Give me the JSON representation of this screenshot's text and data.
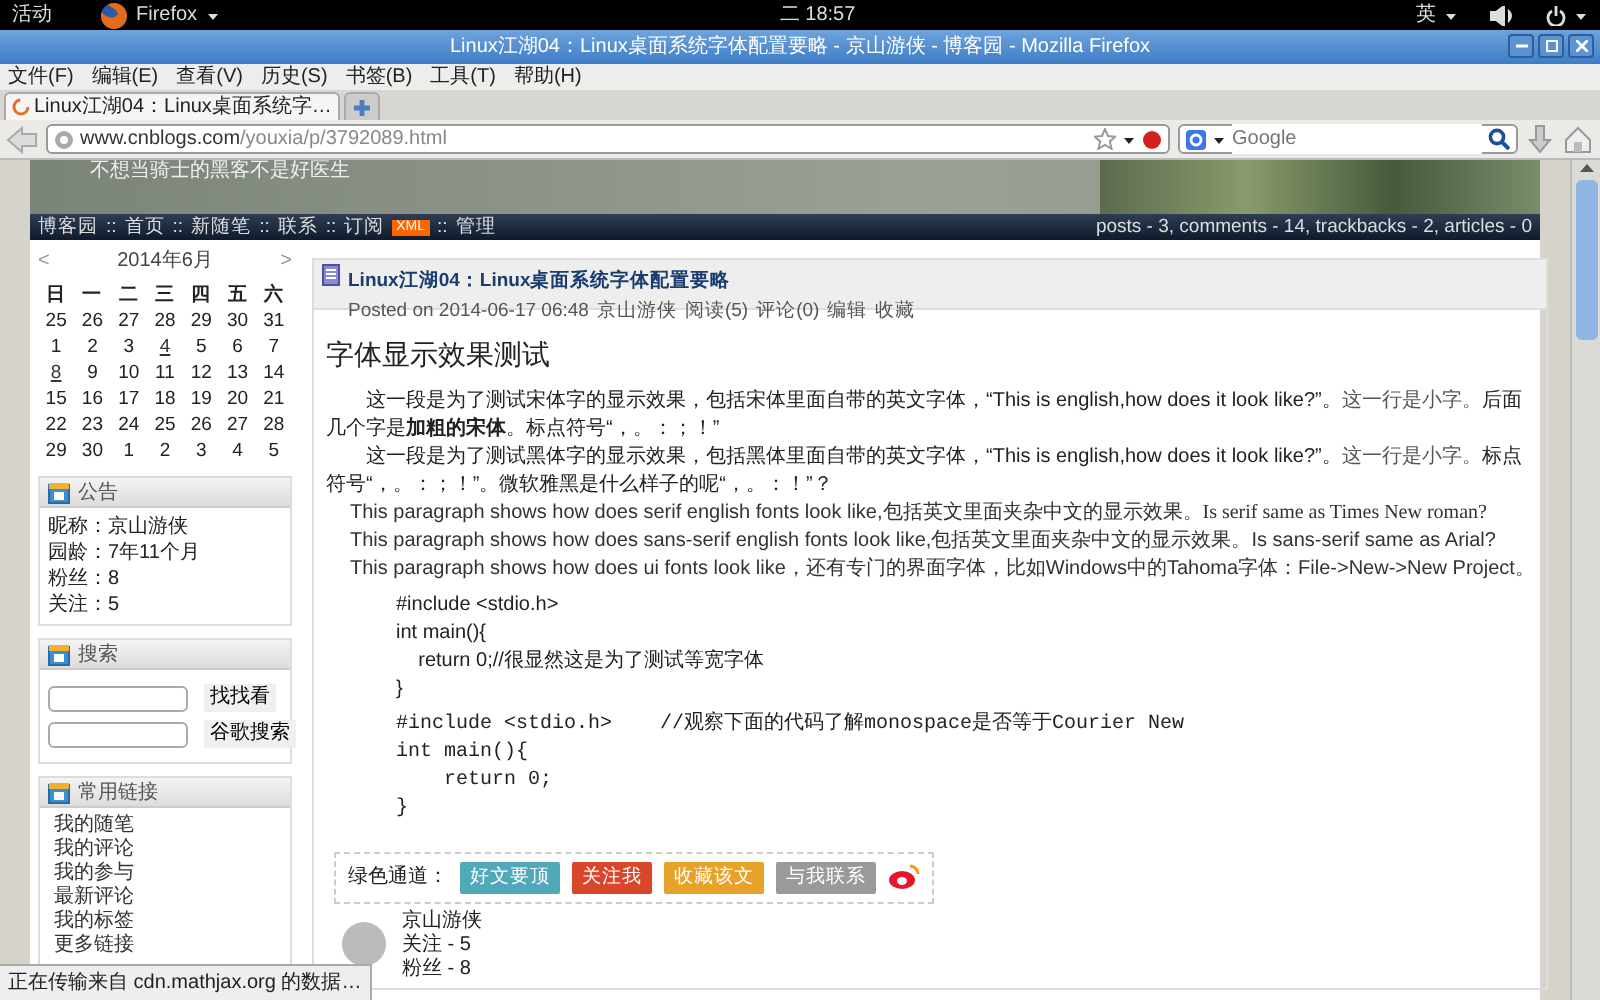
{
  "top_bar": {
    "activities": "活动",
    "app": "Firefox",
    "clock": "二 18:57",
    "input_method": "英"
  },
  "window": {
    "title": "Linux江湖04：Linux桌面系统字体配置要略 - 京山游侠 - 博客园 - Mozilla Firefox"
  },
  "menu": [
    "文件(F)",
    "编辑(E)",
    "查看(V)",
    "历史(S)",
    "书签(B)",
    "工具(T)",
    "帮助(H)"
  ],
  "tabs": [
    {
      "label": "Linux江湖04：Linux桌面系统字…",
      "selected": true
    }
  ],
  "address": {
    "host": "www.cnblogs.com",
    "path": "/youxia/p/3792089.html"
  },
  "search": {
    "placeholder": "Google"
  },
  "blog": {
    "subtitle": "不想当骑士的黑客不是好医生",
    "separator": "::",
    "nav": [
      {
        "label": "博客园"
      },
      {
        "label": "首页"
      },
      {
        "label": "新随笔"
      },
      {
        "label": "联系"
      },
      {
        "label": "订阅",
        "badge": "XML"
      },
      {
        "label": "管理"
      }
    ],
    "stats": "posts - 3, comments - 14, trackbacks - 2, articles - 0"
  },
  "calendar": {
    "prev": "<",
    "title": "2014年6月",
    "next": ">",
    "weekdays": [
      "日",
      "一",
      "二",
      "三",
      "四",
      "五",
      "六"
    ],
    "weeks": [
      [
        {
          "d": "25",
          "link": false
        },
        {
          "d": "26",
          "link": false
        },
        {
          "d": "27",
          "link": false
        },
        {
          "d": "28",
          "link": false
        },
        {
          "d": "29",
          "link": false
        },
        {
          "d": "30",
          "link": false
        },
        {
          "d": "31",
          "link": false
        }
      ],
      [
        {
          "d": "1",
          "link": false
        },
        {
          "d": "2",
          "link": false
        },
        {
          "d": "3",
          "link": false
        },
        {
          "d": "4",
          "link": true
        },
        {
          "d": "5",
          "link": false
        },
        {
          "d": "6",
          "link": false
        },
        {
          "d": "7",
          "link": false
        }
      ],
      [
        {
          "d": "8",
          "link": true
        },
        {
          "d": "9",
          "link": false
        },
        {
          "d": "10",
          "link": false
        },
        {
          "d": "11",
          "link": false
        },
        {
          "d": "12",
          "link": false
        },
        {
          "d": "13",
          "link": false
        },
        {
          "d": "14",
          "link": false
        }
      ],
      [
        {
          "d": "15",
          "link": false
        },
        {
          "d": "16",
          "link": false
        },
        {
          "d": "17",
          "link": false
        },
        {
          "d": "18",
          "link": false
        },
        {
          "d": "19",
          "link": false
        },
        {
          "d": "20",
          "link": false
        },
        {
          "d": "21",
          "link": false
        }
      ],
      [
        {
          "d": "22",
          "link": false
        },
        {
          "d": "23",
          "link": false
        },
        {
          "d": "24",
          "link": false
        },
        {
          "d": "25",
          "link": false
        },
        {
          "d": "26",
          "link": false
        },
        {
          "d": "27",
          "link": false
        },
        {
          "d": "28",
          "link": false
        }
      ],
      [
        {
          "d": "29",
          "link": false
        },
        {
          "d": "30",
          "link": false
        },
        {
          "d": "1",
          "link": false
        },
        {
          "d": "2",
          "link": false
        },
        {
          "d": "3",
          "link": false
        },
        {
          "d": "4",
          "link": false
        },
        {
          "d": "5",
          "link": false
        }
      ]
    ]
  },
  "sidebar": [
    {
      "kind": "info",
      "title": "公告",
      "lines": [
        "昵称：京山游侠",
        "园龄：7年11个月",
        "粉丝：8",
        "关注：5"
      ]
    },
    {
      "kind": "search",
      "title": "搜索",
      "buttons": [
        "找找看",
        "谷歌搜索"
      ]
    },
    {
      "kind": "links",
      "title": "常用链接",
      "links": [
        "我的随笔",
        "我的评论",
        "我的参与",
        "最新评论",
        "我的标签",
        "更多链接"
      ]
    }
  ],
  "post": {
    "title": "Linux江湖04：Linux桌面系统字体配置要略",
    "meta": {
      "posted": "Posted on 2014-06-17 06:48",
      "author": "京山游侠",
      "reads": "阅读(5)",
      "comments": "评论(0)",
      "edit": "编辑",
      "favorite": "收藏"
    },
    "heading": "字体显示效果测试",
    "body": [
      {
        "kind": "para",
        "segments": [
          {
            "kind": "text",
            "text": "这一段是为了测试宋体字的显示效果，包括宋体里面自带的英文字体，“This is english,how does it look like?”。"
          },
          {
            "kind": "small",
            "text": "这一行是小字。"
          },
          {
            "kind": "text",
            "text": "后面几个字是**加粗的宋体**。标点符号“，。：；！”"
          }
        ]
      },
      {
        "kind": "para",
        "segments": [
          {
            "kind": "text",
            "text": "这一段是为了测试黑体字的显示效果，包括黑体里面自带的英文字体，“This is english,how does it look like?”。"
          },
          {
            "kind": "small",
            "text": "这一行是小字。"
          },
          {
            "kind": "text",
            "text": "标点符号“，。：；！”。微软雅黑是什么样子的呢“，。：！”？"
          }
        ]
      },
      {
        "kind": "para_en",
        "segments": [
          {
            "kind": "text",
            "text": "This paragraph shows how does serif english fonts look like,包括英文里面夹杂中文的显示效果。"
          },
          {
            "kind": "serif",
            "text": "Is serif same as Times New roman?"
          }
        ]
      },
      {
        "kind": "para_en",
        "segments": [
          {
            "kind": "text",
            "text": "This paragraph shows how does sans-serif english fonts look like,包括英文里面夹杂中文的显示效果。Is sans-serif same as Arial?"
          }
        ]
      },
      {
        "kind": "para_en",
        "segments": [
          {
            "kind": "text",
            "text": "This paragraph shows how does ui fonts look like，还有专门的界面字体，比如Windows中的Tahoma字体：File->New->New Project。"
          }
        ]
      },
      {
        "kind": "code_sans",
        "lines": [
          "#include <stdio.h>",
          "int main(){",
          "    return 0;//很显然这是为了测试等宽字体",
          "}"
        ]
      },
      {
        "kind": "code_mono",
        "lines": [
          "#include <stdio.h>    //观察下面的代码了解monospace是否等于Courier New",
          "int main(){",
          "    return 0;",
          "}"
        ]
      }
    ],
    "share": {
      "label": "绿色通道：",
      "buttons": [
        {
          "label": "好文要顶",
          "color": "#4fa9b8"
        },
        {
          "label": "关注我",
          "color": "#d9472b"
        },
        {
          "label": "收藏该文",
          "color": "#e8a22a"
        },
        {
          "label": "与我联系",
          "color": "#9a9a9a"
        }
      ]
    },
    "author": {
      "name": "京山游侠",
      "following": "关注 - 5",
      "followers": "粉丝 - 8"
    }
  },
  "status": "正在传输来自 cdn.mathjax.org 的数据…"
}
